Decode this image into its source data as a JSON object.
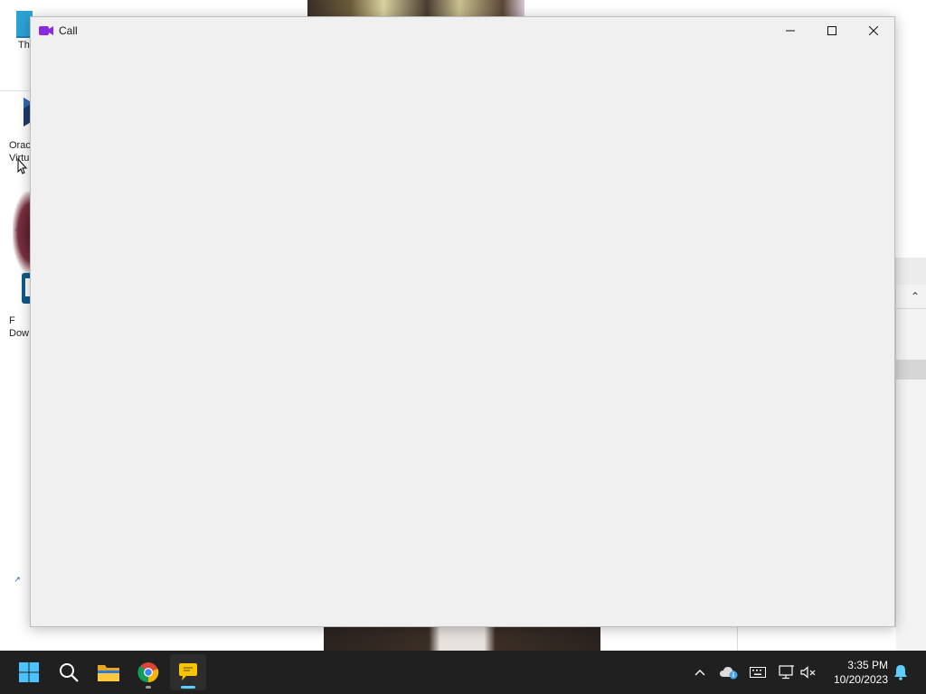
{
  "window": {
    "title": "Call",
    "minimize_label": "",
    "maximize_label": "",
    "close_label": ""
  },
  "desktop": {
    "icons": [
      {
        "label": "Th",
        "icon": "folder-icon"
      },
      {
        "label": "Orac\nVirtu",
        "icon": "virtualbox-icon"
      },
      {
        "label": "F\nDow",
        "icon": "app-shortcut-icon"
      }
    ]
  },
  "taskbar": {
    "apps": [
      {
        "name": "start",
        "icon": "windows-start-icon"
      },
      {
        "name": "search",
        "icon": "search-icon"
      },
      {
        "name": "file-explorer",
        "icon": "folder-icon"
      },
      {
        "name": "chrome",
        "icon": "chrome-icon"
      },
      {
        "name": "chat-app",
        "icon": "chat-bubble-icon"
      }
    ],
    "tray": {
      "time": "3:35 PM",
      "date": "10/20/2023"
    }
  },
  "colors": {
    "accent": "#8a2be2",
    "taskbar_bg": "#202020",
    "window_bg": "#f0f0f0",
    "indicator": "#60cdff"
  }
}
